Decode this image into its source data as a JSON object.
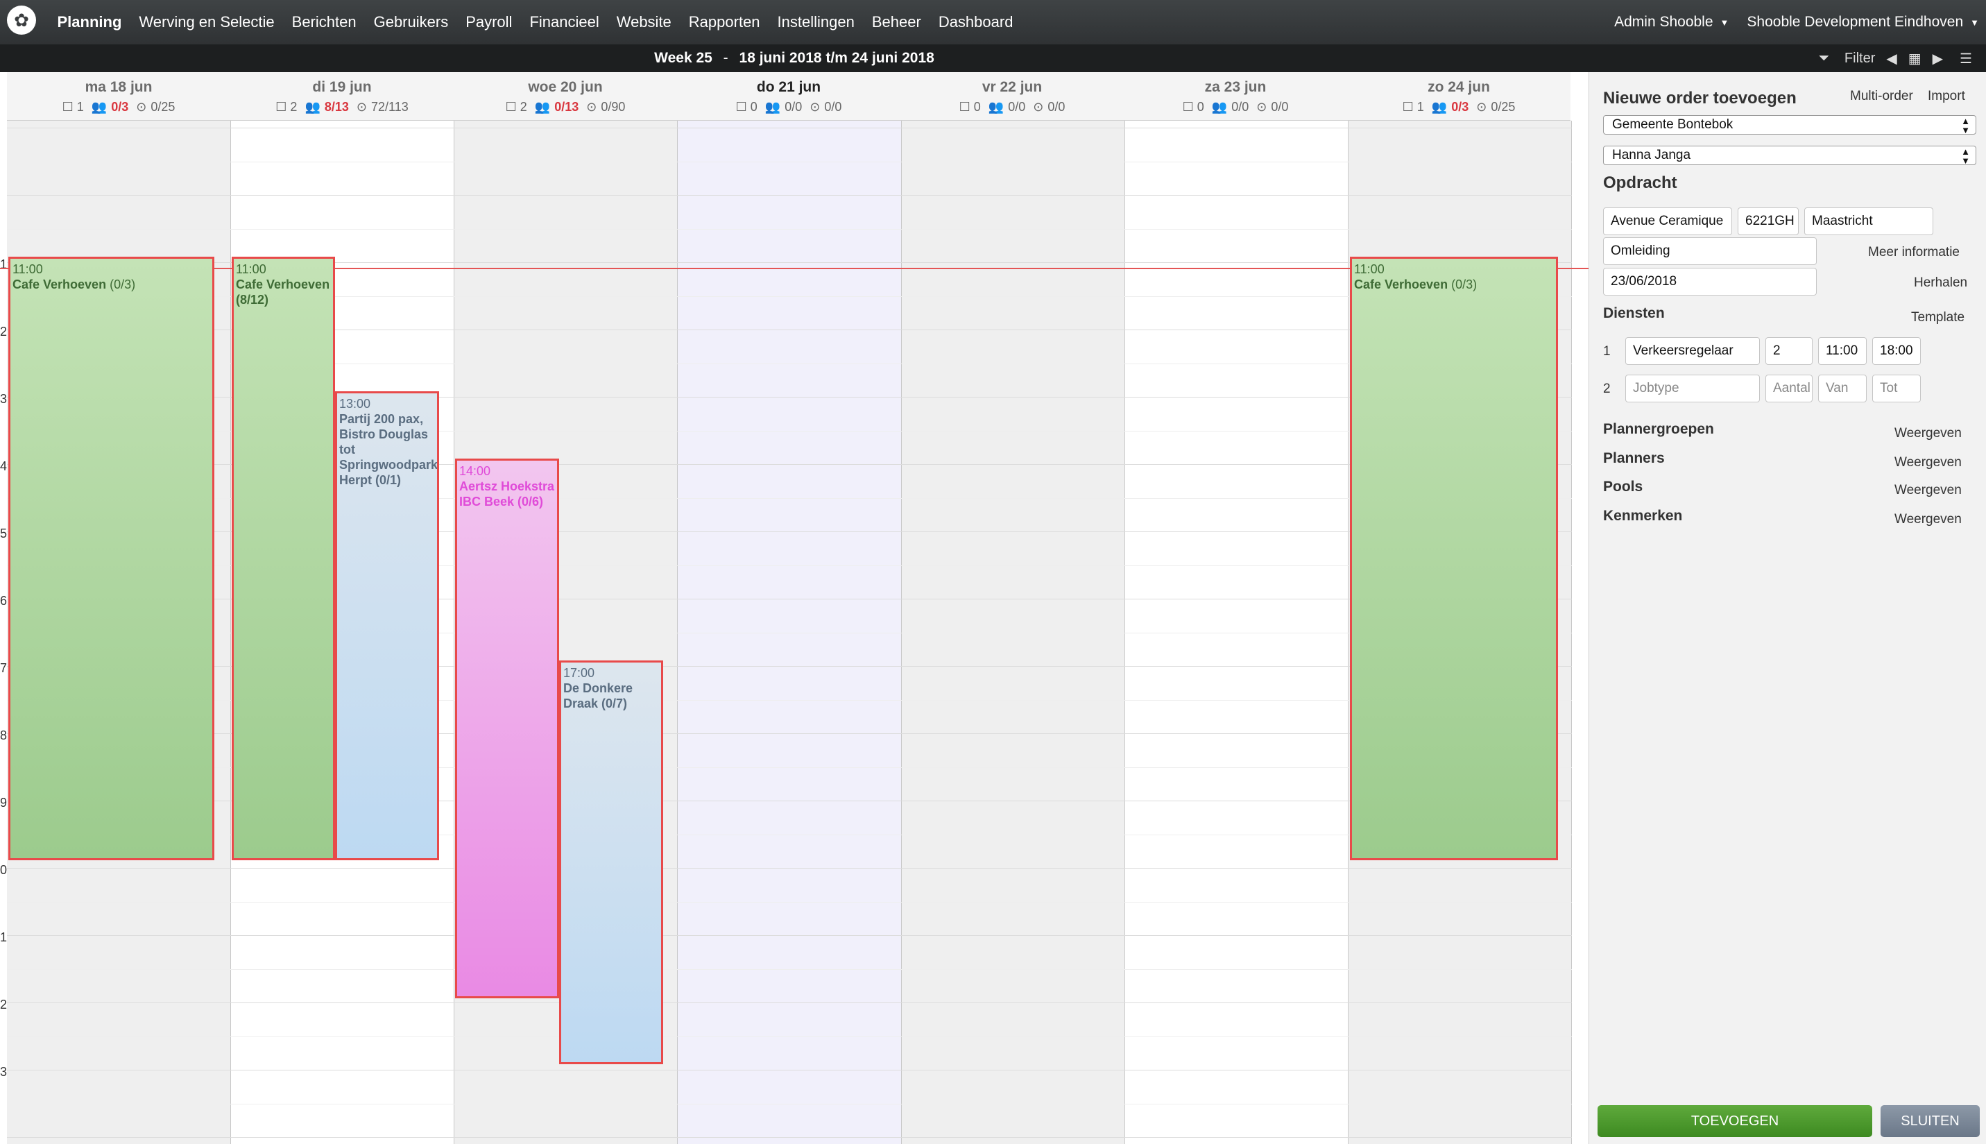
{
  "nav": {
    "logo_icon": "shooble-logo-icon",
    "items": [
      "Planning",
      "Werving en Selectie",
      "Berichten",
      "Gebruikers",
      "Payroll",
      "Financieel",
      "Website",
      "Rapporten",
      "Instellingen",
      "Beheer",
      "Dashboard"
    ],
    "active": "Planning",
    "user": "Admin Shooble",
    "org": "Shooble Development Eindhoven"
  },
  "weekbar": {
    "week": "Week 25",
    "sep": "-",
    "range": "18 juni 2018 t/m 24 juni 2018",
    "filter": "Filter"
  },
  "days": [
    {
      "label": "ma 18 jun",
      "orders": "1",
      "people": "0/3",
      "shifts": "0/25"
    },
    {
      "label": "di 19 jun",
      "orders": "2",
      "people": "8/13",
      "shifts": "72/113"
    },
    {
      "label": "woe 20 jun",
      "orders": "2",
      "people": "0/13",
      "shifts": "0/90"
    },
    {
      "label": "do 21 jun",
      "orders": "0",
      "people": "0/0",
      "shifts": "0/0"
    },
    {
      "label": "vr 22 jun",
      "orders": "0",
      "people": "0/0",
      "shifts": "0/0"
    },
    {
      "label": "za 23 jun",
      "orders": "0",
      "people": "0/0",
      "shifts": "0/0"
    },
    {
      "label": "zo 24 jun",
      "orders": "1",
      "people": "0/3",
      "shifts": "0/25"
    }
  ],
  "hour_labels": [
    "1",
    "2",
    "3",
    "4",
    "5",
    "6",
    "7",
    "8",
    "9",
    "0",
    "1",
    "2",
    "3"
  ],
  "events": [
    {
      "time": "11:00",
      "name": "Cafe Verhoeven",
      "count": "(0/3)"
    },
    {
      "time": "11:00",
      "name": "Cafe Verhoeven (8/12)",
      "count": ""
    },
    {
      "time": "13:00",
      "name": "Partij 200 pax, Bistro Douglas tot Springwoodpark Herpt (0/1)",
      "count": ""
    },
    {
      "time": "14:00",
      "name": "Aertsz Hoekstra IBC Beek (0/6)",
      "count": ""
    },
    {
      "time": "17:00",
      "name": "De Donkere Draak (0/7)",
      "count": ""
    },
    {
      "time": "11:00",
      "name": "Cafe Verhoeven",
      "count": "(0/3)"
    }
  ],
  "panel": {
    "title": "Nieuwe order toevoegen",
    "multi_order": "Multi-order",
    "import": "Import",
    "client": "Gemeente Bontebok",
    "contact": "Hanna Janga",
    "opdracht": "Opdracht",
    "street": "Avenue Ceramique",
    "postcode": "6221GH",
    "city": "Maastricht",
    "description": "Omleiding",
    "meer_info": "Meer informatie",
    "date": "23/06/2018",
    "herhalen": "Herhalen",
    "diensten": "Diensten",
    "template": "Template",
    "services": [
      {
        "num": "1",
        "jobtype": "Verkeersregelaar",
        "amount": "2",
        "from": "11:00",
        "to": "18:00"
      },
      {
        "num": "2",
        "jobtype": "Jobtype",
        "amount": "Aantal",
        "from": "Van",
        "to": "Tot"
      }
    ],
    "sections": [
      {
        "label": "Plannergroepen",
        "action": "Weergeven"
      },
      {
        "label": "Planners",
        "action": "Weergeven"
      },
      {
        "label": "Pools",
        "action": "Weergeven"
      },
      {
        "label": "Kenmerken",
        "action": "Weergeven"
      }
    ],
    "add_button": "TOEVOEGEN",
    "close_button": "SLUITEN"
  }
}
